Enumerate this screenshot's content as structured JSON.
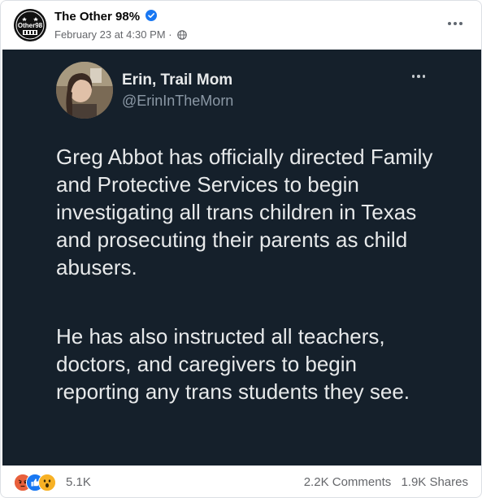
{
  "post": {
    "page_name": "The Other 98%",
    "timestamp": "February 23 at 4:30 PM",
    "separator": "·",
    "audience_icon": "globe-icon",
    "avatar_text": "Other98"
  },
  "tweet": {
    "display_name": "Erin, Trail Mom",
    "handle": "@ErinInTheMorn",
    "paragraph_1": "Greg Abbot has officially directed Family and Protective Services to begin investigating all trans children in Texas and prosecuting their parents as child abusers.",
    "paragraph_2": "He has also instructed all teachers, doctors, and caregivers to begin reporting any trans students they see."
  },
  "footer": {
    "reaction_count": "5.1K",
    "reaction_icons": [
      "angry-icon",
      "like-icon",
      "wow-icon"
    ],
    "comments": "2.2K Comments",
    "shares": "1.9K Shares"
  },
  "colors": {
    "tweet_bg": "#15202b",
    "verified": "#1877f2",
    "meta_text": "#65676b"
  }
}
